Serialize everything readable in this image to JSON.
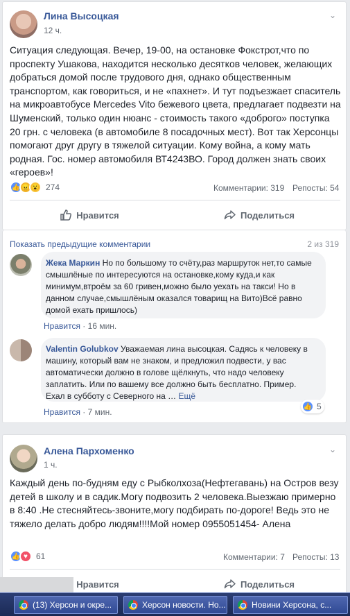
{
  "post1": {
    "author": "Лина Высоцкая",
    "time": "12 ч.",
    "text": "Ситуация следующая. Вечер, 19-00, на остановке Фокстрот,что по проспекту Ушакова, находится несколько десятков человек, желающих добраться домой после трудового дня, однако общественным транспортом, как говориться, и не «пахнет». И тут подъезжает спаситель на микроавтобусе Mercedes Vito бежевого цвета, предлагает подвезти на Шуменский, только один нюанс - стоимость такого «доброго» поступка 20 грн. с человека (в автомобиле 8 посадочных мест). Вот так Херсонцы помогают друг другу в тяжелой ситуации. Кому война, а кому мать родная. Гос. номер автомобиля ВТ4243ВО. Город должен знать своих «героев»!",
    "reaction_count": "274",
    "comments": "Комментарии: 319",
    "shares": "Репосты: 54",
    "like_label": "Нравится",
    "share_label": "Поделиться",
    "prev_comments": "Показать предыдущие комментарии",
    "comment_counter": "2 из 319",
    "comment1": {
      "author": "Жека Маркин",
      "text": "Но по большому то счёту,раз маршруток нет,то самые смышлёные по интересуются на остановке,кому куда,и как минимум,втроём за 60 гривен,можно было уехать на такси! Но в данном случае,смышлёным оказался товарищ на Вито)Всё равно домой ехать пришлось)",
      "like": "Нравится",
      "time": "16 мин."
    },
    "comment2": {
      "author": "Valentin Golubkov",
      "text": "Уважаемая лина высоцкая. Садясь к человеку в машину, который вам не знаком, и предложил подвести, у вас автоматически должно в голове щёлкнуть, что надо человеку заплатить. Или по вашему все должно быть бесплатно. Пример. Ехал в субботу с Северного на …",
      "more": "Ещё",
      "likes": "5",
      "like": "Нравится",
      "time": "7 мин."
    }
  },
  "post2": {
    "author": "Алена Пархоменко",
    "time": "1 ч.",
    "text": "Каждый день по-будням еду с Рыбколхоза(Нефтегавань) на Остров везу детей в школу и в садик.Могу подвозить 2 человека.Выезжаю примерно в 8:40 .Не стесняйтесь-звоните,могу подбирать по-дороге! Ведь это не тяжело делать добро людям!!!!Мой номер 0955051454- Алена",
    "reaction_count": "61",
    "comments": "Комментарии: 7",
    "shares": "Репосты: 13",
    "like_label": "Нравится",
    "share_label": "Поделиться"
  },
  "taskbar": {
    "tabs": [
      "(13) Херсон и окре...",
      "Херсон новости. Но...",
      "Новини Херсона, с..."
    ]
  },
  "colors": {
    "link": "#385898",
    "like_blue": "#5890ff",
    "taskbar": "#2c3e74"
  }
}
